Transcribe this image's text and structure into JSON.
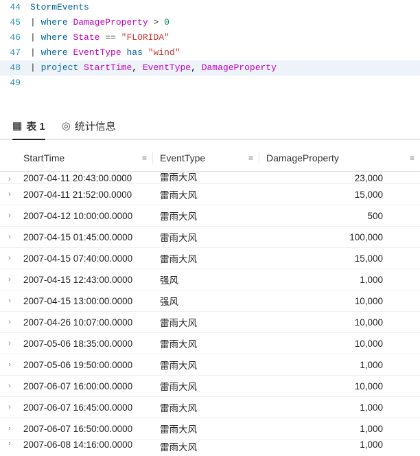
{
  "editor": {
    "lines": [
      {
        "num": "44",
        "hl": false,
        "tokens": [
          {
            "t": "StormEvents",
            "c": "tok-id"
          }
        ]
      },
      {
        "num": "45",
        "hl": false,
        "tokens": [
          {
            "t": "| ",
            "c": "tok-pipe"
          },
          {
            "t": "where",
            "c": "tok-kw"
          },
          {
            "t": " ",
            "c": ""
          },
          {
            "t": "DamageProperty",
            "c": "tok-col"
          },
          {
            "t": " > ",
            "c": "tok-op"
          },
          {
            "t": "0",
            "c": "tok-num"
          }
        ]
      },
      {
        "num": "46",
        "hl": false,
        "tokens": [
          {
            "t": "| ",
            "c": "tok-pipe"
          },
          {
            "t": "where",
            "c": "tok-kw"
          },
          {
            "t": " ",
            "c": ""
          },
          {
            "t": "State",
            "c": "tok-col"
          },
          {
            "t": " == ",
            "c": "tok-op"
          },
          {
            "t": "\"FLORIDA\"",
            "c": "tok-str"
          }
        ]
      },
      {
        "num": "47",
        "hl": false,
        "tokens": [
          {
            "t": "| ",
            "c": "tok-pipe"
          },
          {
            "t": "where",
            "c": "tok-kw"
          },
          {
            "t": " ",
            "c": ""
          },
          {
            "t": "EventType",
            "c": "tok-col"
          },
          {
            "t": " ",
            "c": ""
          },
          {
            "t": "has",
            "c": "tok-kw"
          },
          {
            "t": " ",
            "c": ""
          },
          {
            "t": "\"wind\"",
            "c": "tok-str"
          }
        ]
      },
      {
        "num": "48",
        "hl": true,
        "tokens": [
          {
            "t": "| ",
            "c": "tok-pipe"
          },
          {
            "t": "project",
            "c": "tok-kw"
          },
          {
            "t": " ",
            "c": ""
          },
          {
            "t": "StartTime",
            "c": "tok-col"
          },
          {
            "t": ", ",
            "c": ""
          },
          {
            "t": "EventType",
            "c": "tok-col"
          },
          {
            "t": ", ",
            "c": ""
          },
          {
            "t": "DamageProperty",
            "c": "tok-col"
          }
        ]
      },
      {
        "num": "49",
        "hl": false,
        "tokens": []
      }
    ]
  },
  "tabs": {
    "table_icon": "▦",
    "table_label": "表 1",
    "stats_icon": "◎",
    "stats_label": "统计信息"
  },
  "columns": {
    "start": "StartTime",
    "type": "EventType",
    "dmg": "DamageProperty",
    "menu_glyph": "≡"
  },
  "rows": [
    {
      "expand": "›",
      "start": "2007-04-11 20:43:00.0000",
      "type": "雷雨大风",
      "dmg": "23,000",
      "clip": "top"
    },
    {
      "expand": "›",
      "start": "2007-04-11 21:52:00.0000",
      "type": "雷雨大风",
      "dmg": "15,000"
    },
    {
      "expand": "›",
      "start": "2007-04-12 10:00:00.0000",
      "type": "雷雨大风",
      "dmg": "500"
    },
    {
      "expand": "›",
      "start": "2007-04-15 01:45:00.0000",
      "type": "雷雨大风",
      "dmg": "100,000"
    },
    {
      "expand": "›",
      "start": "2007-04-15 07:40:00.0000",
      "type": "雷雨大风",
      "dmg": "15,000"
    },
    {
      "expand": "›",
      "start": "2007-04-15 12:43:00.0000",
      "type": "强风",
      "dmg": "1,000"
    },
    {
      "expand": "›",
      "start": "2007-04-15 13:00:00.0000",
      "type": "强风",
      "dmg": "10,000"
    },
    {
      "expand": "›",
      "start": "2007-04-26 10:07:00.0000",
      "type": "雷雨大风",
      "dmg": "10,000"
    },
    {
      "expand": "›",
      "start": "2007-05-06 18:35:00.0000",
      "type": "雷雨大风",
      "dmg": "10,000"
    },
    {
      "expand": "›",
      "start": "2007-05-06 19:50:00.0000",
      "type": "雷雨大风",
      "dmg": "1,000"
    },
    {
      "expand": "›",
      "start": "2007-06-07 16:00:00.0000",
      "type": "雷雨大风",
      "dmg": "10,000"
    },
    {
      "expand": "›",
      "start": "2007-06-07 16:45:00.0000",
      "type": "雷雨大风",
      "dmg": "1,000"
    },
    {
      "expand": "›",
      "start": "2007-06-07 16:50:00.0000",
      "type": "雷雨大风",
      "dmg": "1,000"
    },
    {
      "expand": "›",
      "start": "2007-06-08 14:16:00.0000",
      "type": "雷雨大风",
      "dmg": "1,000",
      "clip": "bottom"
    }
  ]
}
